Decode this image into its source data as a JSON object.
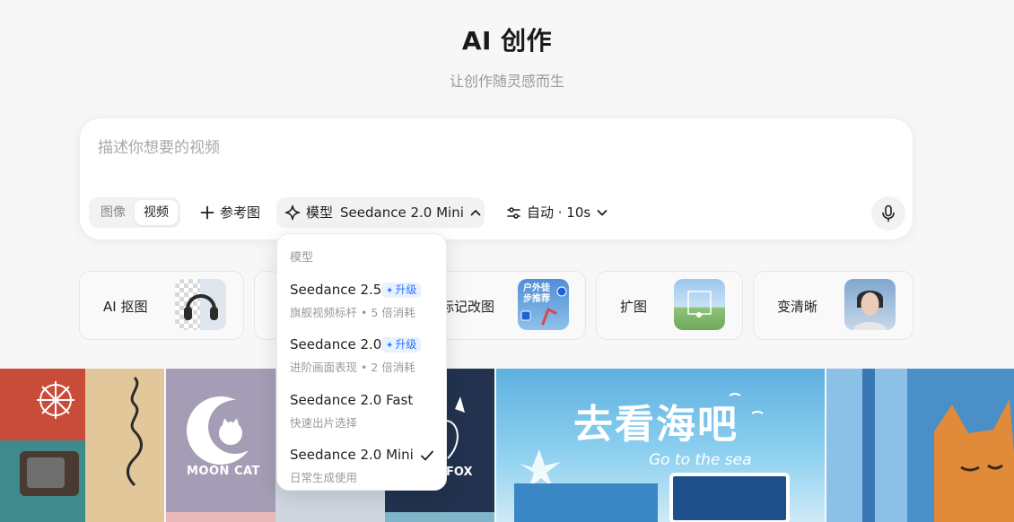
{
  "header": {
    "title": "AI 创作",
    "subtitle": "让创作随灵感而生"
  },
  "prompt": {
    "placeholder": "描述你想要的视频"
  },
  "toolbar": {
    "mode_image": "图像",
    "mode_video": "视频",
    "reference_label": "参考图",
    "model_label": "模型",
    "model_value": "Seedance 2.0 Mini",
    "auto_label": "自动 · 10s"
  },
  "model_menu": {
    "header": "模型",
    "items": [
      {
        "name": "Seedance 2.5",
        "badge": "升级",
        "desc": "旗舰视频标杆 • 5 倍消耗",
        "selected": false
      },
      {
        "name": "Seedance 2.0",
        "badge": "升级",
        "desc": "进阶画面表现 • 2 倍消耗",
        "selected": false
      },
      {
        "name": "Seedance 2.0 Fast",
        "badge": "",
        "desc": "快速出片选择",
        "selected": false
      },
      {
        "name": "Seedance 2.0 Mini",
        "badge": "",
        "desc": "日常生成使用",
        "selected": true
      }
    ]
  },
  "features": [
    {
      "label": "AI 抠图",
      "thumb_text": ""
    },
    {
      "label": "",
      "thumb_text": ""
    },
    {
      "label": "标记改图",
      "thumb_text": "户外徒步推荐"
    },
    {
      "label": "扩图",
      "thumb_text": ""
    },
    {
      "label": "变清晰",
      "thumb_text": ""
    }
  ],
  "gallery": {
    "moon_cat_text": "MOON CAT",
    "fox_text": "FOX",
    "sea_title": "去看海吧",
    "sea_subtitle": "Go to the sea"
  },
  "colors": {
    "accent": "#2d74ff",
    "background": "#f7f7f8"
  }
}
